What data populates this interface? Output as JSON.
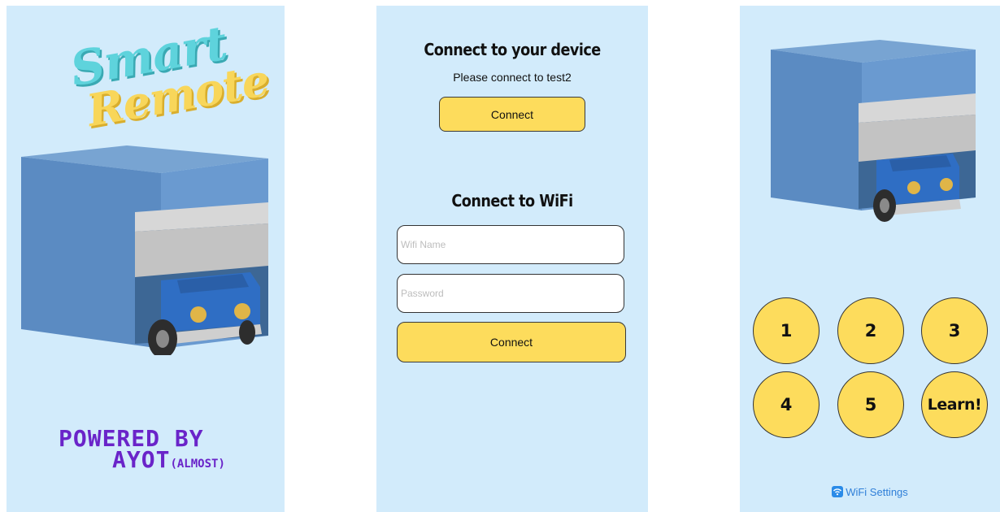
{
  "splash": {
    "logo_line1": "Smart",
    "logo_line2": "Remote",
    "powered_line1": "POWERED BY",
    "powered_line2": "AYOT",
    "powered_suffix": "(ALMOST)"
  },
  "connect": {
    "device_title": "Connect to your device",
    "device_message": "Please connect to test2",
    "device_button": "Connect",
    "wifi_title": "Connect to WiFi",
    "wifi_name_placeholder": "Wifi Name",
    "password_placeholder": "Password",
    "wifi_button": "Connect"
  },
  "remote": {
    "buttons": [
      "1",
      "2",
      "3",
      "4",
      "5",
      "Learn!"
    ],
    "wifi_settings_label": "WiFi Settings"
  },
  "colors": {
    "screen_background": "#d2ebfb",
    "button_yellow": "#fddc5c",
    "link_blue": "#2f7fd8",
    "brand_purple": "#6a24c9"
  }
}
